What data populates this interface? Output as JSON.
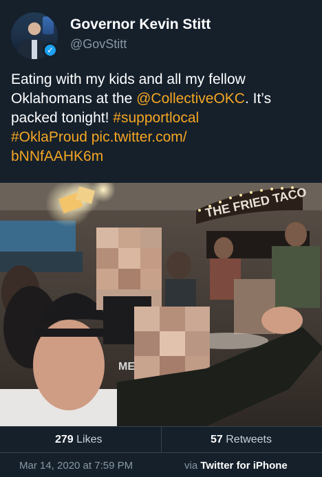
{
  "profile": {
    "name": "Governor Kevin Stitt",
    "handle": "@GovStitt"
  },
  "tweet": {
    "line1": "Eating with my kids and all my fellow",
    "line2a": "Oklahomans at the ",
    "mention": "@CollectiveOKC",
    "line2b": ". It’s",
    "line3a": "packed tonight! ",
    "hashtag1": "#supportlocal",
    "hashtag2": "#OklaProud",
    "link1": "pic.twitter.com/",
    "link2": "bNNfAAHK6m"
  },
  "photo": {
    "sign_text": "THE FRIED TACO",
    "shirt_text": "ME"
  },
  "stats": {
    "likes_count": "279",
    "likes_label": "Likes",
    "retweets_count": "57",
    "retweets_label": "Retweets"
  },
  "meta": {
    "timestamp": "Mar 14, 2020 at 7:59 PM",
    "via_prefix": "via ",
    "client": "Twitter for iPhone"
  },
  "colors": {
    "background": "#15202b",
    "link": "#f5a623",
    "verified": "#1da1f2",
    "muted": "#8899a6"
  }
}
